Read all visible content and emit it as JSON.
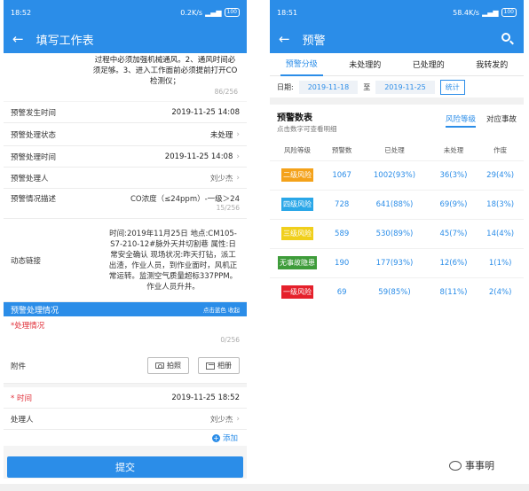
{
  "left": {
    "status": {
      "time": "18:52",
      "speed": "0.2K/s",
      "battery": "100"
    },
    "title": "填写工作表",
    "desc_text": "过程中必须加强机械通风。2、通风时间必须足够。3、进入工作面前必须提前打开CO检测仪；",
    "desc_counter": "86/256",
    "rows": {
      "time_label": "预警发生时间",
      "time_value": "2019-11-25 14:08",
      "state_label": "预警处理状态",
      "state_value": "未处理",
      "handle_time_label": "预警处理时间",
      "handle_time_value": "2019-11-25 14:08",
      "handler_label": "预警处理人",
      "handler_value": "刘少杰",
      "desc_label": "预警情况描述",
      "desc_value": "CO浓度（≤24ppm）-一级＞24",
      "desc_value_counter": "15/256",
      "link_label": "动态链接",
      "link_value": "时间:2019年11月25日 地点:CM105-S7-210-12#脉外天井切割巷 属性:日常安全确认 现场状况:昨天打钻，派工出渣，作业人员，到作业面时，风机正常运转。监测空气质量超标337PPM。作业人员升井。"
    },
    "section": {
      "title": "预警处理情况",
      "hint": "点击蓝色 收起"
    },
    "handling_label": "*处理情况",
    "handling_counter": "0/256",
    "attachment_label": "附件",
    "photo_btn": "拍照",
    "album_btn": "相册",
    "time2_label": "* 时间",
    "time2_value": "2019-11-25 18:52",
    "processor_label": "处理人",
    "processor_value": "刘少杰",
    "add_label": "添加",
    "submit_label": "提交"
  },
  "right": {
    "status": {
      "time": "18:51",
      "speed": "58.4K/s",
      "battery": "100"
    },
    "title": "预警",
    "tabs": [
      "预警分级",
      "未处理的",
      "已处理的",
      "我转发的"
    ],
    "date_label": "日期:",
    "date_from": "2019-11-18",
    "date_sep": "至",
    "date_to": "2019-11-25",
    "stat_btn": "统计",
    "table_title": "预警数表",
    "table_subtitle": "点击数字可查看明细",
    "subtabs": [
      "风险等级",
      "对应事故"
    ],
    "columns": [
      "风险等级",
      "预警数",
      "已处理",
      "未处理",
      "作废"
    ],
    "rows": [
      {
        "level": "二级风险",
        "color": "#f4a21a",
        "count": "1067",
        "done": "1002(93%)",
        "pending": "36(3%)",
        "void": "29(4%)"
      },
      {
        "level": "四级风险",
        "color": "#2aa7e8",
        "count": "728",
        "done": "641(88%)",
        "pending": "69(9%)",
        "void": "18(3%)"
      },
      {
        "level": "三级风险",
        "color": "#f0cf1c",
        "count": "589",
        "done": "530(89%)",
        "pending": "45(7%)",
        "void": "14(4%)"
      },
      {
        "level": "无事故隐患",
        "color": "#3e9c3a",
        "count": "190",
        "done": "177(93%)",
        "pending": "12(6%)",
        "void": "1(1%)"
      },
      {
        "level": "一级风险",
        "color": "#e5202b",
        "count": "69",
        "done": "59(85%)",
        "pending": "8(11%)",
        "void": "2(4%)"
      }
    ]
  },
  "watermark": "事事明"
}
